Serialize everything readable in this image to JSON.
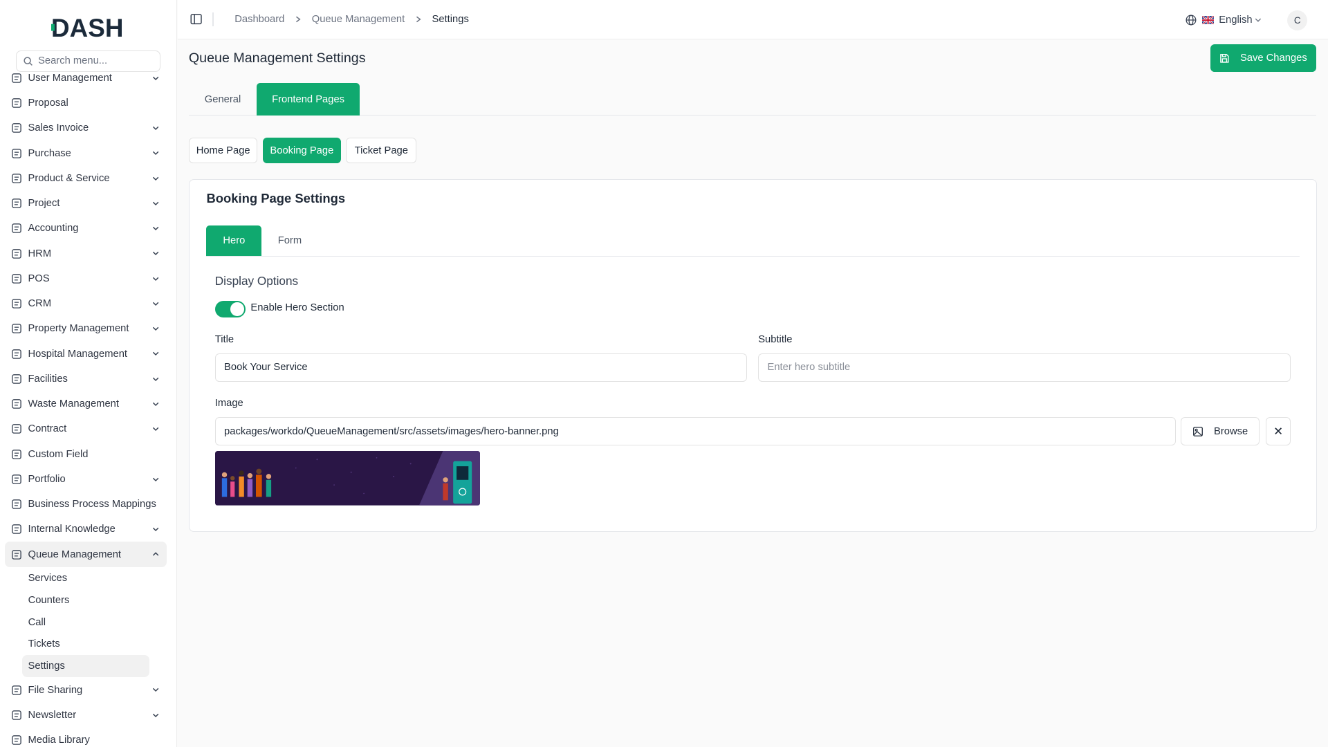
{
  "app": {
    "logo_text": "DASH"
  },
  "sidebar": {
    "search_placeholder": "Search menu...",
    "items": [
      {
        "label": "User Management",
        "icon": "users-icon"
      },
      {
        "label": "Proposal",
        "icon": "proposal-icon"
      },
      {
        "label": "Sales Invoice",
        "icon": "invoice-icon"
      },
      {
        "label": "Purchase",
        "icon": "cart-icon"
      },
      {
        "label": "Product & Service",
        "icon": "layers-icon"
      },
      {
        "label": "Project",
        "icon": "project-icon"
      },
      {
        "label": "Accounting",
        "icon": "calculator-icon"
      },
      {
        "label": "HRM",
        "icon": "hrm-icon"
      },
      {
        "label": "POS",
        "icon": "store-icon"
      },
      {
        "label": "CRM",
        "icon": "crm-icon"
      },
      {
        "label": "Property Management",
        "icon": "property-icon"
      },
      {
        "label": "Hospital Management",
        "icon": "stethoscope-icon"
      },
      {
        "label": "Facilities",
        "icon": "building-icon"
      },
      {
        "label": "Waste Management",
        "icon": "recycle-icon"
      },
      {
        "label": "Contract",
        "icon": "contract-icon"
      },
      {
        "label": "Custom Field",
        "icon": "field-icon"
      },
      {
        "label": "Portfolio",
        "icon": "briefcase-icon"
      },
      {
        "label": "Business Process Mappings",
        "icon": "process-icon"
      },
      {
        "label": "Internal Knowledge",
        "icon": "book-icon"
      },
      {
        "label": "Queue Management",
        "icon": "phone-icon"
      }
    ],
    "queue_sub": [
      "Services",
      "Counters",
      "Call",
      "Tickets",
      "Settings"
    ],
    "bottom_items": [
      {
        "label": "File Sharing",
        "icon": "file-icon"
      },
      {
        "label": "Newsletter",
        "icon": "megaphone-icon"
      },
      {
        "label": "Media Library",
        "icon": "image-icon"
      }
    ]
  },
  "topbar": {
    "breadcrumb": [
      "Dashboard",
      "Queue Management",
      "Settings"
    ],
    "language": "English",
    "avatar_initial": "C"
  },
  "page": {
    "title": "Queue Management Settings",
    "save_label": "Save Changes",
    "tabs": [
      "General",
      "Frontend Pages"
    ],
    "active_tab": "Frontend Pages",
    "page_pills": [
      "Home Page",
      "Booking Page",
      "Ticket Page"
    ],
    "active_pill": "Booking Page"
  },
  "card": {
    "title": "Booking Page Settings",
    "tabs": [
      "Hero",
      "Form"
    ],
    "active_tab": "Hero",
    "display_options": "Display Options",
    "enable_hero_label": "Enable Hero Section",
    "enable_hero_on": true,
    "title_label": "Title",
    "title_value": "Book Your Service",
    "subtitle_label": "Subtitle",
    "subtitle_placeholder": "Enter hero subtitle",
    "image_label": "Image",
    "image_value": "packages/workdo/QueueManagement/src/assets/images/hero-banner.png",
    "browse_label": "Browse"
  },
  "colors": {
    "accent": "#10a96f",
    "banner_bg": "#2a1646",
    "kiosk": "#14a39a"
  }
}
